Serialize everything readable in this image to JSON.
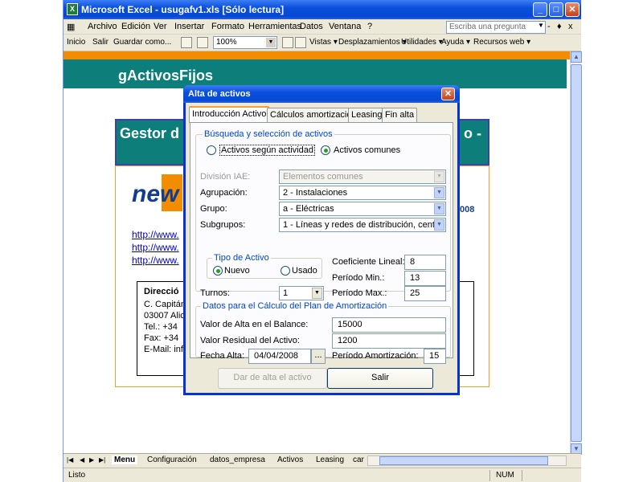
{
  "window": {
    "title": "Microsoft Excel - usugafv1.xls  [Sólo lectura]",
    "min": "_",
    "max": "□",
    "close": "✕"
  },
  "menu": {
    "items": [
      "Archivo",
      "Edición",
      "Ver",
      "Insertar",
      "Formato",
      "Herramientas",
      "Datos",
      "Ventana",
      "?"
    ],
    "ask_placeholder": "Escriba una pregunta",
    "doc_controls": [
      "-",
      "♦",
      "x"
    ]
  },
  "toolbar": {
    "inicio": "Inicio",
    "salir": "Salir",
    "guardar": "Guardar como...",
    "zoom": "100%",
    "vistas": "Vistas ▾",
    "desplazamientos": "Desplazamientos ▾",
    "utilidades": "Utilidades ▾",
    "ayuda": "Ayuda ▾",
    "recursos": "Recursos web ▾"
  },
  "sheet": {
    "app_title": "gActivosFijos",
    "gestor_title": "Gestor d",
    "gestor_suffix": "o -",
    "logo": "new",
    "links": [
      "http://www.",
      "http://www.",
      "http://www."
    ],
    "year_fragment": "008",
    "address": {
      "heading": "Direcció",
      "lines": [
        "C. Capitán",
        "03007 Alic",
        "Tel.: +34 ",
        "Fax:  +34 ",
        "E-Mail: inf"
      ]
    }
  },
  "dialog": {
    "title": "Alta de activos",
    "close": "✕",
    "tabs": [
      "Introducción Activo",
      "Cálculos amortización",
      "Leasing",
      "Fin alta"
    ],
    "busqueda": {
      "legend": "Búsqueda y selección de activos",
      "radio1": "Activos según actividad",
      "radio2": "Activos comunes"
    },
    "fields": {
      "division_label": "División IAE:",
      "division_value": "Elementos comunes",
      "agrupacion_label": "Agrupación:",
      "agrupacion_value": "2 - Instalaciones",
      "grupo_label": "Grupo:",
      "grupo_value": "a - Eléctricas",
      "subgrupos_label": "Subgrupos:",
      "subgrupos_value": "1 - Líneas y redes de distribución, centr"
    },
    "tipo": {
      "legend": "Tipo de Activo",
      "nuevo": "Nuevo",
      "usado": "Usado"
    },
    "turnos_label": "Turnos:",
    "turnos_value": "1",
    "coef_label": "Coeficiente Lineal:",
    "coef_value": "8",
    "pmin_label": "Período Min.:",
    "pmin_value": "13",
    "pmax_label": "Período Max.:",
    "pmax_value": "25",
    "plan": {
      "legend": "Datos para el Cálculo del Plan de Amortización",
      "valor_alta_label": "Valor de Alta en el Balance:",
      "valor_alta_value": "15000",
      "valor_residual_label": "Valor Residual del Activo:",
      "valor_residual_value": "1200",
      "fecha_label": "Fecha Alta:",
      "fecha_value": "04/04/2008",
      "fecha_btn": "...",
      "periodo_label": "Período Amortización:",
      "periodo_value": "15"
    },
    "btn_alta": "Dar de alta el activo",
    "btn_salir": "Salir"
  },
  "sheettabs": {
    "nav": [
      "|◀",
      "◀",
      "▶",
      "▶|"
    ],
    "tabs": [
      "Menu",
      "Configuración",
      "datos_empresa",
      "Activos",
      "Leasing",
      "car"
    ]
  },
  "status": {
    "left": "Listo",
    "num": "NUM"
  }
}
